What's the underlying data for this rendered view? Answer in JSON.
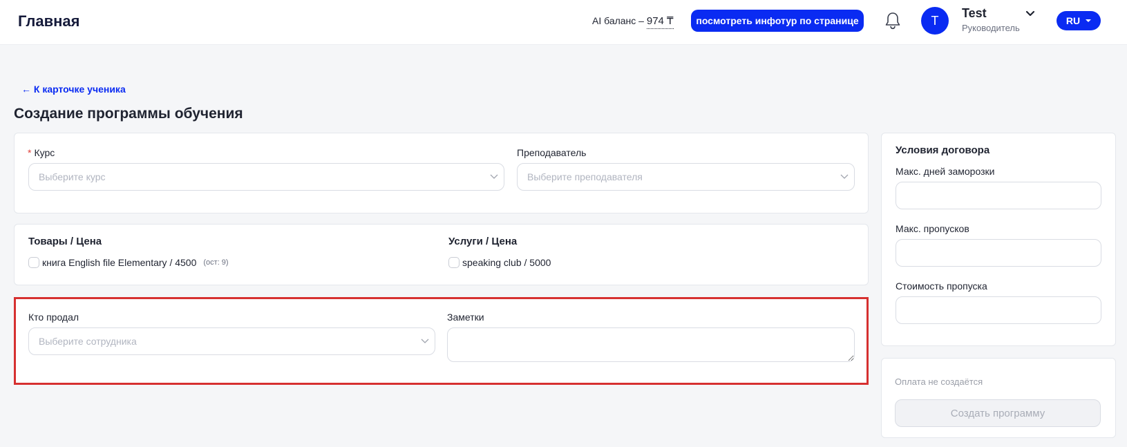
{
  "header": {
    "title": "Главная",
    "ai_balance_label": "AI баланс –",
    "ai_balance_amount": "974 ₸",
    "tour_button": "посмотреть инфотур по странице",
    "user_initial": "T",
    "user_name": "Test",
    "user_role": "Руководитель",
    "language": "RU"
  },
  "nav": {
    "back_link": "← К карточке ученика"
  },
  "form": {
    "title": "Создание программы обучения",
    "course": {
      "required_mark": "*",
      "label": "Курс",
      "placeholder": "Выберите курс"
    },
    "teacher": {
      "label": "Преподаватель",
      "placeholder": "Выберите преподавателя"
    },
    "goods": {
      "title": "Товары / Цена",
      "items": [
        {
          "label": "книга English file Elementary / 4500",
          "note": "(ост: 9)"
        }
      ]
    },
    "services": {
      "title": "Услуги / Цена",
      "items": [
        {
          "label": "speaking club / 5000"
        }
      ]
    },
    "seller": {
      "label": "Кто продал",
      "placeholder": "Выберите сотрудника"
    },
    "notes": {
      "label": "Заметки",
      "value": ""
    }
  },
  "contract": {
    "title": "Условия договора",
    "max_freeze_days_label": "Макс. дней заморозки",
    "max_absences_label": "Макс. пропусков",
    "absence_cost_label": "Стоимость пропуска"
  },
  "payment": {
    "note": "Оплата не создаётся",
    "create_button": "Создать программу"
  },
  "colors": {
    "accent": "#0a2bf2",
    "highlight": "#d63030",
    "required": "#e0403a"
  }
}
